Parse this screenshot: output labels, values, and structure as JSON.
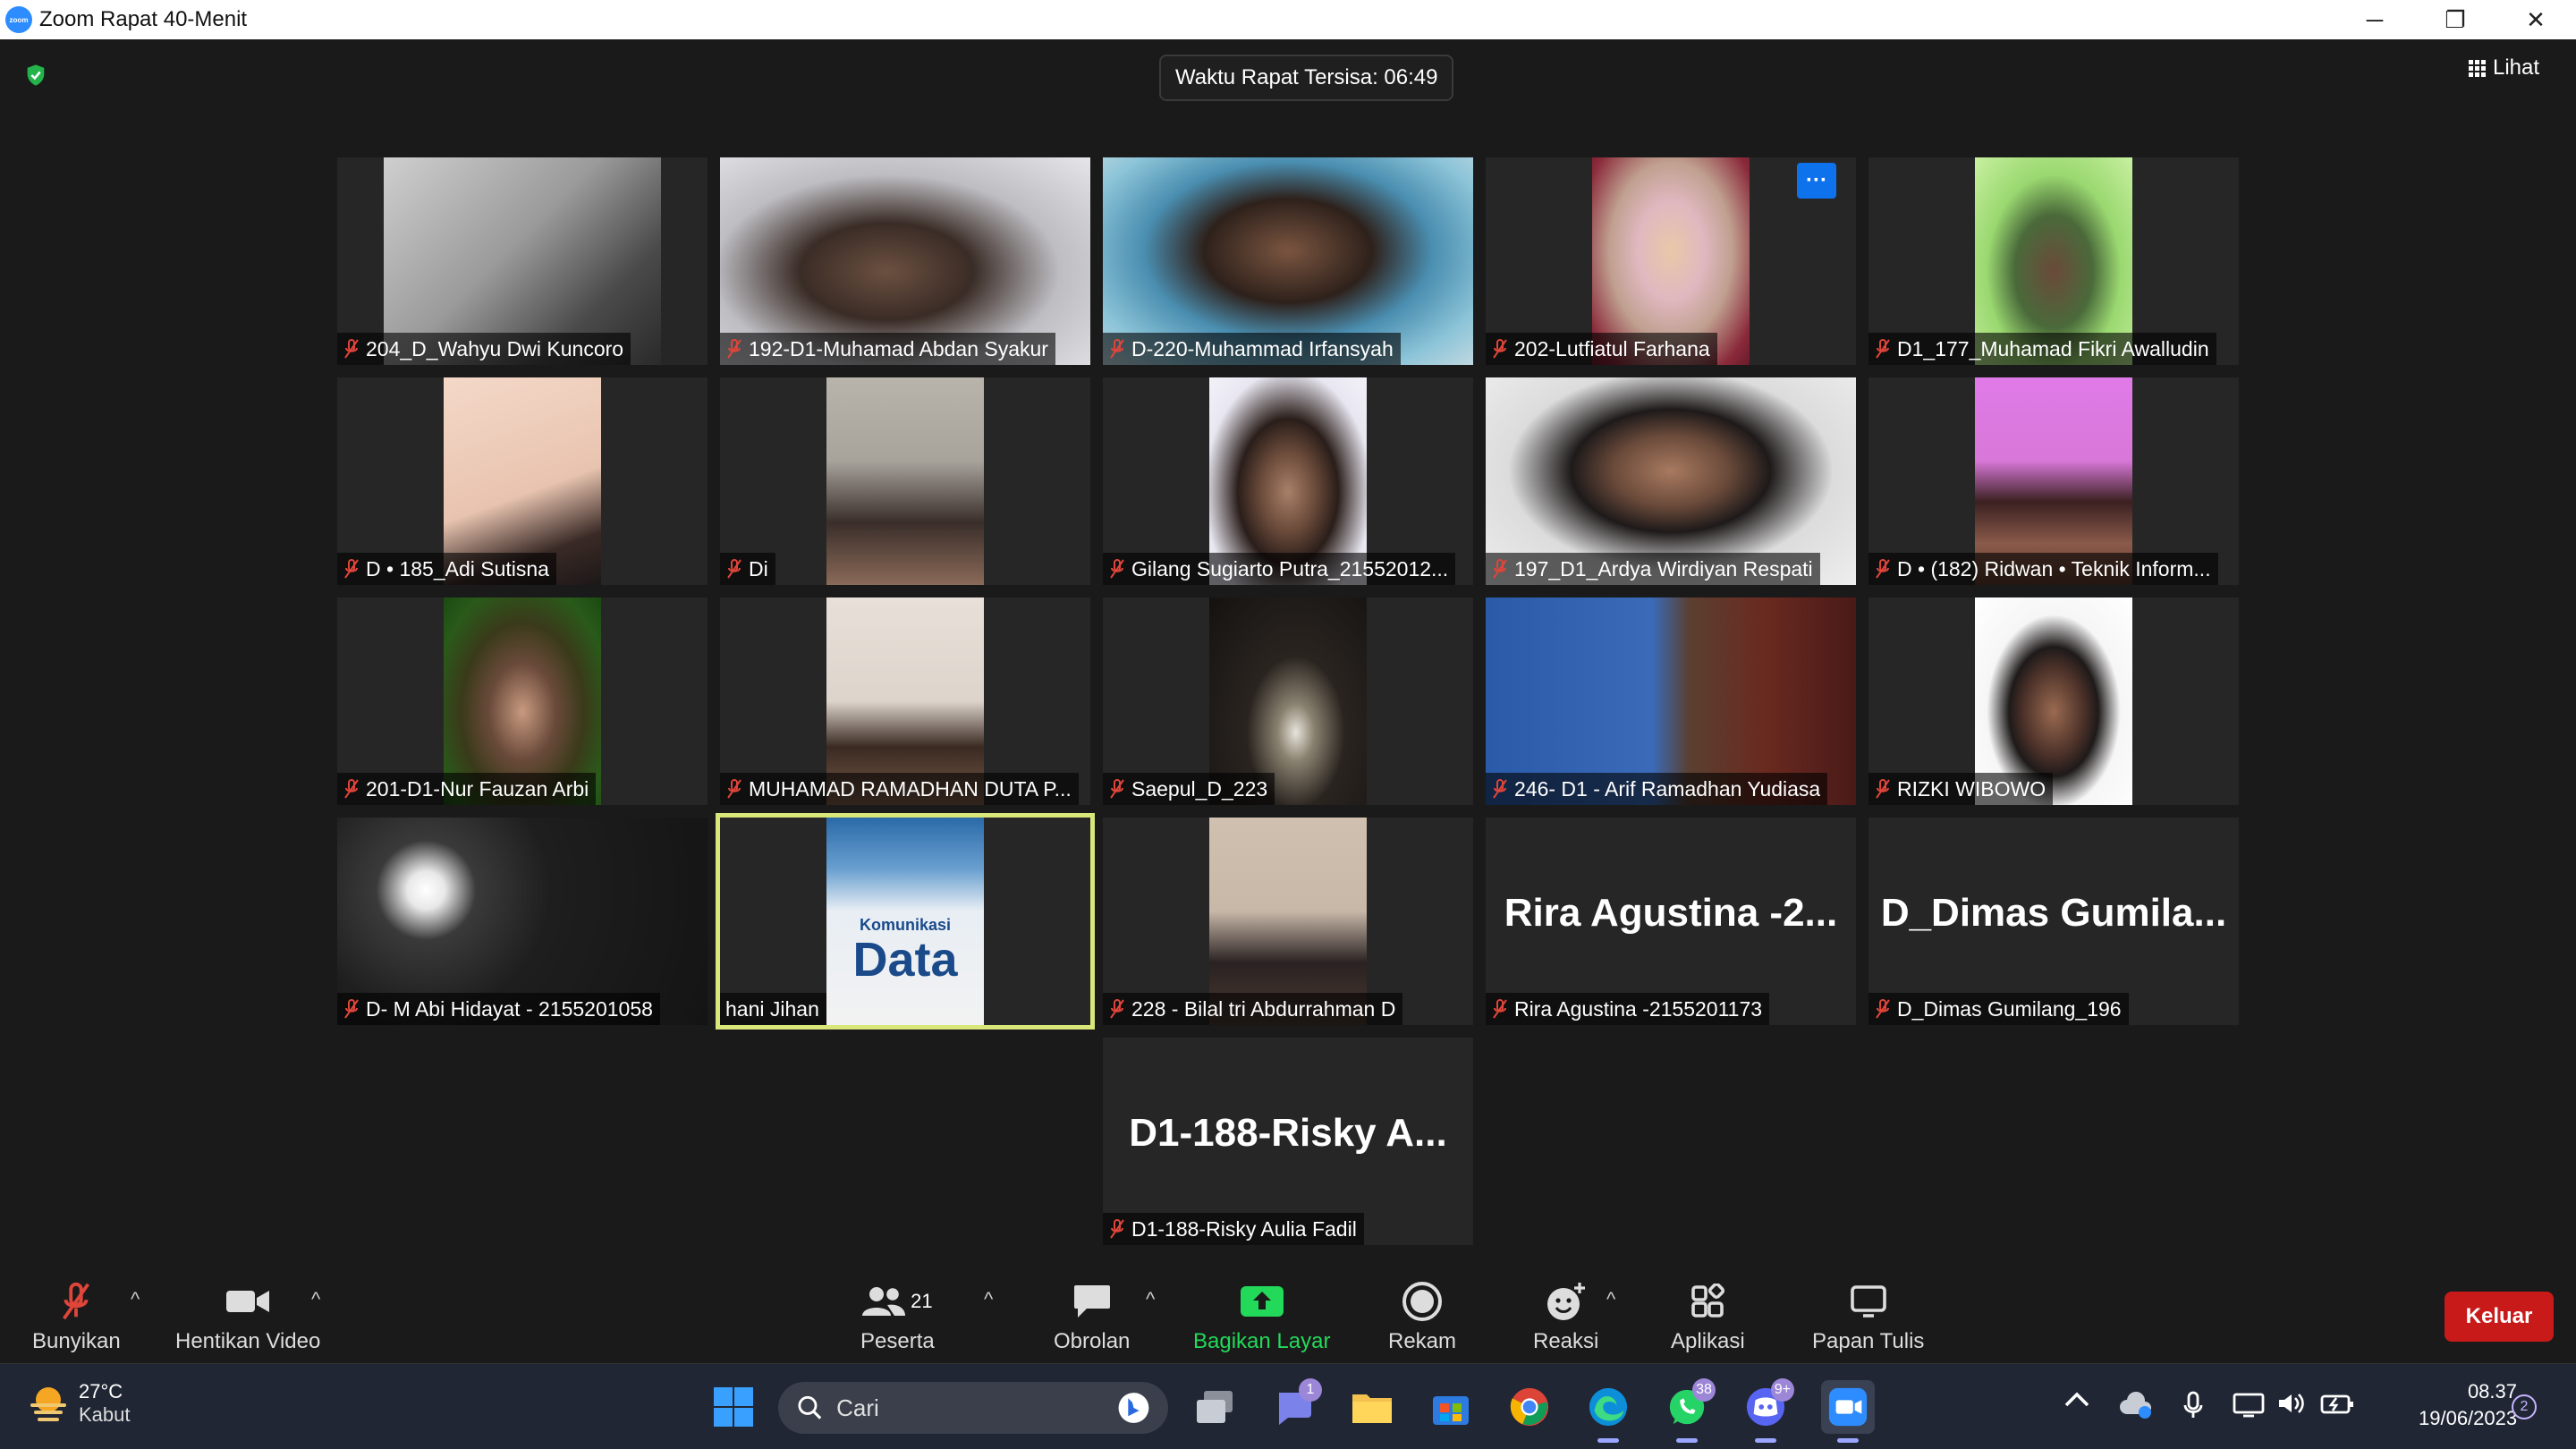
{
  "window": {
    "title": "Zoom Rapat 40-Menit",
    "logo_text": "zoom",
    "minimize": "─",
    "restore": "❐",
    "close": "✕"
  },
  "meeting": {
    "timer": "Waktu Rapat Tersisa: 06:49",
    "view_label": "Lihat",
    "more_button": "···",
    "participants": [
      {
        "name": "204_D_Wahyu Dwi Kuncoro",
        "muted": true
      },
      {
        "name": "192-D1-Muhamad Abdan Syakur",
        "muted": true
      },
      {
        "name": "D-220-Muhammad Irfansyah",
        "muted": true
      },
      {
        "name": "202-Lutfiatul Farhana",
        "muted": true
      },
      {
        "name": "D1_177_Muhamad Fikri Awalludin",
        "muted": true
      },
      {
        "name": "D • 185_Adi Sutisna",
        "muted": true
      },
      {
        "name": "Di",
        "muted": true
      },
      {
        "name": "Gilang Sugiarto Putra_21552012...",
        "muted": true
      },
      {
        "name": "197_D1_Ardya Wirdiyan Respati",
        "muted": true
      },
      {
        "name": "D • (182) Ridwan • Teknik Inform...",
        "muted": true
      },
      {
        "name": "201-D1-Nur Fauzan Arbi",
        "muted": true
      },
      {
        "name": "MUHAMAD RAMADHAN DUTA P...",
        "muted": true
      },
      {
        "name": "Saepul_D_223",
        "muted": true
      },
      {
        "name": "246- D1 - Arif Ramadhan Yudiasa",
        "muted": true
      },
      {
        "name": "RIZKI WIBOWO",
        "muted": true
      },
      {
        "name": "D- M Abi Hidayat - 2155201058",
        "muted": true
      },
      {
        "name": "hani Jihan",
        "muted": false
      },
      {
        "name": "228 - Bilal tri Abdurrahman D",
        "muted": true
      },
      {
        "name": "Rira Agustina -2155201173",
        "muted": true,
        "display": "Rira Agustina -2..."
      },
      {
        "name": "D_Dimas Gumilang_196",
        "muted": true,
        "display": "D_Dimas Gumila..."
      },
      {
        "name": "D1-188-Risky Aulia Fadil",
        "muted": true,
        "display": "D1-188-Risky A..."
      }
    ],
    "book_cover": {
      "small": "Komunikasi",
      "big": "Data"
    }
  },
  "toolbar": {
    "unmute": "Bunyikan",
    "stop_video": "Hentikan Video",
    "participants": "Peserta",
    "participants_count": "21",
    "chat": "Obrolan",
    "share_screen": "Bagikan Layar",
    "record": "Rekam",
    "reactions": "Reaksi",
    "apps": "Aplikasi",
    "whiteboard": "Papan Tulis",
    "leave": "Keluar",
    "caret": "^"
  },
  "taskbar": {
    "weather_temp": "27°C",
    "weather_cond": "Kabut",
    "search_placeholder": "Cari",
    "teams_badge": "1",
    "whatsapp_badge": "38",
    "discord_badge": "9+",
    "time": "08.37",
    "date": "19/06/2023",
    "notifications": "2"
  },
  "colors": {
    "accent": "#2d8cff",
    "active_speaker": "#d9e77a",
    "leave": "#c91a1a",
    "share_green": "#23d959",
    "muted_red": "#e0453a"
  }
}
